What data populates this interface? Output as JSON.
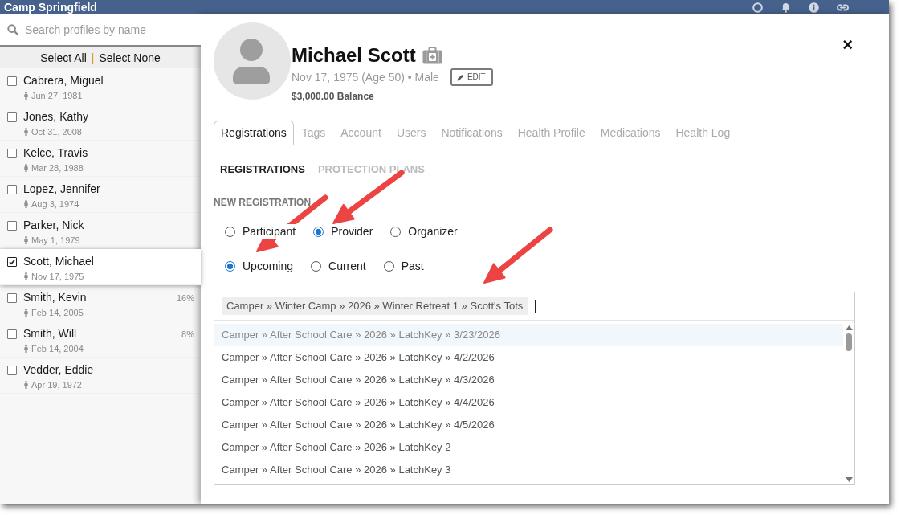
{
  "app": {
    "title": "Camp Springfield"
  },
  "sidebar": {
    "search": {
      "placeholder": "Search profiles by name"
    },
    "select_all": "Select All",
    "separator": "|",
    "select_none": "Select None",
    "profiles": [
      {
        "name": "Cabrera, Miguel",
        "birth_date": "Jun 27, 1981",
        "checked": false,
        "selected": false
      },
      {
        "name": "Jones, Kathy",
        "birth_date": "Oct 31, 2008",
        "checked": false,
        "selected": false
      },
      {
        "name": "Kelce, Travis",
        "birth_date": "Mar 28, 1988",
        "checked": false,
        "selected": false
      },
      {
        "name": "Lopez, Jennifer",
        "birth_date": "Aug 3, 1974",
        "checked": false,
        "selected": false
      },
      {
        "name": "Parker, Nick",
        "birth_date": "May 1, 1979",
        "checked": false,
        "selected": false
      },
      {
        "name": "Scott, Michael",
        "birth_date": "Nov 17, 1975",
        "checked": true,
        "selected": true
      },
      {
        "name": "Smith, Kevin",
        "birth_date": "Feb 14, 2005",
        "percent": "16%",
        "checked": false,
        "selected": false
      },
      {
        "name": "Smith, Will",
        "birth_date": "Feb 14, 2004",
        "percent": "8%",
        "checked": false,
        "selected": false
      },
      {
        "name": "Vedder, Eddie",
        "birth_date": "Apr 19, 1972",
        "checked": false,
        "selected": false
      }
    ]
  },
  "profile": {
    "name": "Michael Scott",
    "details": "Nov 17, 1975 (Age 50) • Male",
    "edit_button": "EDIT",
    "balance": "$3,000.00 Balance",
    "close": "×"
  },
  "tabs": [
    {
      "label": "Registrations",
      "selected": true
    },
    {
      "label": "Tags",
      "selected": false
    },
    {
      "label": "Account",
      "selected": false
    },
    {
      "label": "Users",
      "selected": false
    },
    {
      "label": "Notifications",
      "selected": false
    },
    {
      "label": "Health Profile",
      "selected": false
    },
    {
      "label": "Medications",
      "selected": false
    },
    {
      "label": "Health Log",
      "selected": false
    }
  ],
  "subtabs": [
    {
      "label": "REGISTRATIONS",
      "selected": true
    },
    {
      "label": "PROTECTION PLANS",
      "selected": false
    }
  ],
  "new_registration": {
    "heading": "NEW REGISTRATION",
    "roles": [
      {
        "label": "Participant",
        "selected": false
      },
      {
        "label": "Provider",
        "selected": true
      },
      {
        "label": "Organizer",
        "selected": false
      }
    ],
    "periods": [
      {
        "label": "Upcoming",
        "selected": true
      },
      {
        "label": "Current",
        "selected": false
      },
      {
        "label": "Past",
        "selected": false
      }
    ],
    "field": {
      "value": "Camper » Winter Camp » 2026 » Winter Retreat 1 » Scott's Tots",
      "options": [
        {
          "label": "Camper » After School Care » 2026 » LatchKey » 3/23/2026",
          "selected": true
        },
        {
          "label": "Camper » After School Care » 2026 » LatchKey » 4/2/2026",
          "selected": false
        },
        {
          "label": "Camper » After School Care » 2026 » LatchKey » 4/3/2026",
          "selected": false
        },
        {
          "label": "Camper » After School Care » 2026 » LatchKey » 4/4/2026",
          "selected": false
        },
        {
          "label": "Camper » After School Care » 2026 » LatchKey » 4/5/2026",
          "selected": false
        },
        {
          "label": "Camper » After School Care » 2026 » LatchKey 2",
          "selected": false
        },
        {
          "label": "Camper » After School Care » 2026 » LatchKey 3",
          "selected": false
        }
      ]
    }
  },
  "annotations": [
    {
      "kind": "arrow"
    },
    {
      "kind": "arrow"
    },
    {
      "kind": "arrow"
    }
  ]
}
